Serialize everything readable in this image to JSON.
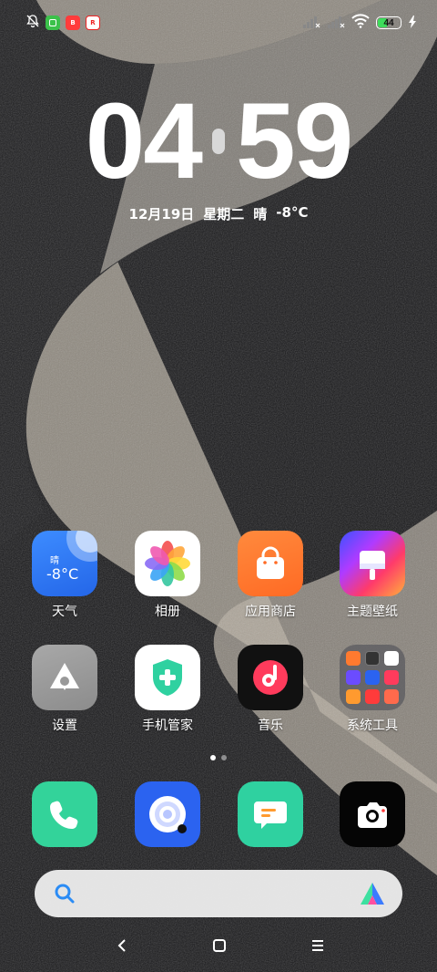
{
  "status_bar": {
    "battery": "44",
    "icons": [
      "bell-off-icon",
      "green-app-icon",
      "red-app-icon",
      "red-app-icon-2",
      "signal-off-icon",
      "signal-off-icon",
      "wifi-icon",
      "charging-icon"
    ]
  },
  "clock": {
    "hours": "04",
    "minutes": "59",
    "date": "12月19日",
    "weekday": "星期二",
    "weather": "晴",
    "temp": "-8°C"
  },
  "apps": [
    {
      "label": "天气",
      "icon": "weather-icon",
      "widget_text": "晴",
      "widget_temp": "-8°C"
    },
    {
      "label": "相册",
      "icon": "gallery-icon"
    },
    {
      "label": "应用商店",
      "icon": "store-icon"
    },
    {
      "label": "主题壁纸",
      "icon": "theme-icon"
    },
    {
      "label": "设置",
      "icon": "settings-icon"
    },
    {
      "label": "手机管家",
      "icon": "security-icon"
    },
    {
      "label": "音乐",
      "icon": "music-icon"
    },
    {
      "label": "系统工具",
      "icon": "folder-icon"
    }
  ],
  "dock": [
    {
      "icon": "phone-icon"
    },
    {
      "icon": "browser-icon"
    },
    {
      "icon": "messages-icon"
    },
    {
      "icon": "camera-icon"
    }
  ],
  "page_indicator": {
    "pages": 2,
    "current": 1
  },
  "colors": {
    "weather": "#2f7bf5",
    "store": "#ff7a2f",
    "phone": "#33d39a",
    "browser": "#2b63f0",
    "messages": "#2fd1a0"
  }
}
